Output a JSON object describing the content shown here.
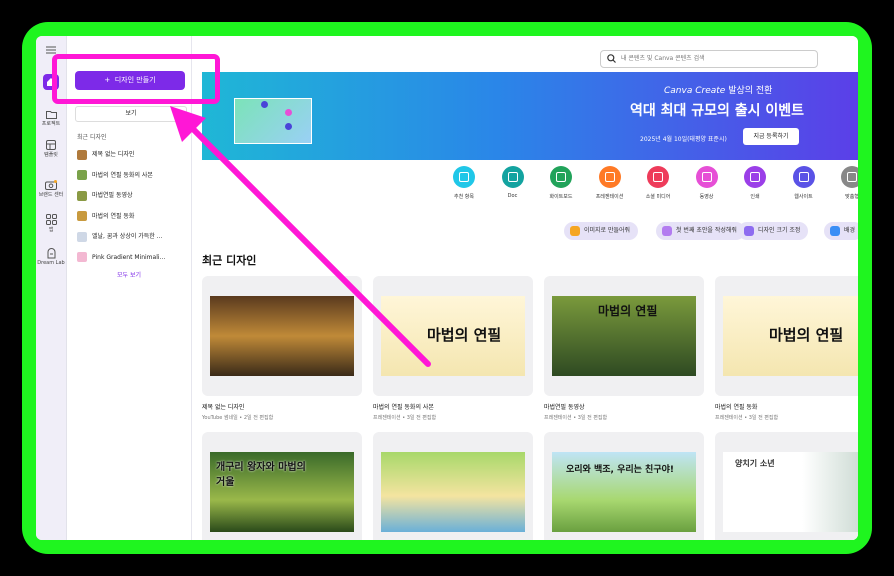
{
  "colors": {
    "frame": "#1ff51f",
    "accent": "#7d2ae8",
    "annotation": "#ff17d6"
  },
  "rail": {
    "items": [
      {
        "label": "프로젝트",
        "icon": "folder-icon"
      },
      {
        "label": "템플릿",
        "icon": "template-icon"
      },
      {
        "label": "브랜드 센터",
        "icon": "brand-icon"
      },
      {
        "label": "앱",
        "icon": "apps-icon"
      },
      {
        "label": "Dream Lab",
        "icon": "dream-lab-icon"
      }
    ]
  },
  "panel": {
    "create_label": "디자인 만들기",
    "view_label": "보기",
    "recent_label": "최근 디자인",
    "recent_items": [
      {
        "label": "제목 없는 디자인",
        "color": "#b07a3c"
      },
      {
        "label": "마법의 연필 동화의 사본",
        "color": "#7aa24a"
      },
      {
        "label": "마법연필 동영상",
        "color": "#8a9a44"
      },
      {
        "label": "마법의 연필 동화",
        "color": "#c89a3e"
      },
      {
        "label": "엘날, 꿈과 상상이 가득한 ...",
        "color": "#cfd8e6"
      },
      {
        "label": "Pink Gradient Minimali...",
        "color": "#f3b8d2"
      }
    ],
    "see_all": "모두 보기"
  },
  "search": {
    "placeholder": "내 콘텐츠 및 Canva 콘텐츠 검색"
  },
  "banner": {
    "brand": "Canva Create",
    "brand_suffix": "발상의 전환",
    "title": "역대 최대 규모의 출시 이벤트",
    "date": "2025년 4월 10일(태평양 표준시)",
    "cta": "지금 등록하기"
  },
  "categories": [
    {
      "label": "추천 항목",
      "color": "#20c7e8"
    },
    {
      "label": "Doc",
      "color": "#13a3a0"
    },
    {
      "label": "화이트보드",
      "color": "#21a35a"
    },
    {
      "label": "프레젠테이션",
      "color": "#ff7a26"
    },
    {
      "label": "소셜 미디어",
      "color": "#ee3b5a"
    },
    {
      "label": "동영상",
      "color": "#e64fd6"
    },
    {
      "label": "인쇄",
      "color": "#9b3fe8"
    },
    {
      "label": "웹사이트",
      "color": "#5a52e6"
    },
    {
      "label": "맞춤형",
      "color": "#888888"
    }
  ],
  "chips": [
    {
      "label": "이미지로 만들어줘",
      "color": "#f5a623"
    },
    {
      "label": "첫 번째 초안을 작성해줘",
      "color": "#b37cf0"
    },
    {
      "label": "디자인 크기 조정",
      "color": "#8e6cf0"
    },
    {
      "label": "배경",
      "color": "#3a8ef5"
    }
  ],
  "recent_title": "최근 디자인",
  "designs": [
    {
      "title": "제목 없는 디자인",
      "sub": "YouTube 썸네일 • 2일 전 편집함",
      "text": ""
    },
    {
      "title": "마법의 연필 동화의 사본",
      "sub": "프레젠테이션 • 3일 전 편집함",
      "text": "마법의 연필"
    },
    {
      "title": "마법연필 동영상",
      "sub": "프레젠테이션 • 3일 전 편집함",
      "text": "마법의 연필"
    },
    {
      "title": "마법의 연필 동화",
      "sub": "프레젠테이션 • 3일 전 편집함",
      "text": "마법의 연필"
    },
    {
      "title": "",
      "sub": "",
      "text": "개구리 왕자와 마법의 거울"
    },
    {
      "title": "",
      "sub": "",
      "text": ""
    },
    {
      "title": "",
      "sub": "",
      "text": "오리와 백조, 우리는 친구야!"
    },
    {
      "title": "",
      "sub": "",
      "text": "양치기 소년"
    }
  ]
}
